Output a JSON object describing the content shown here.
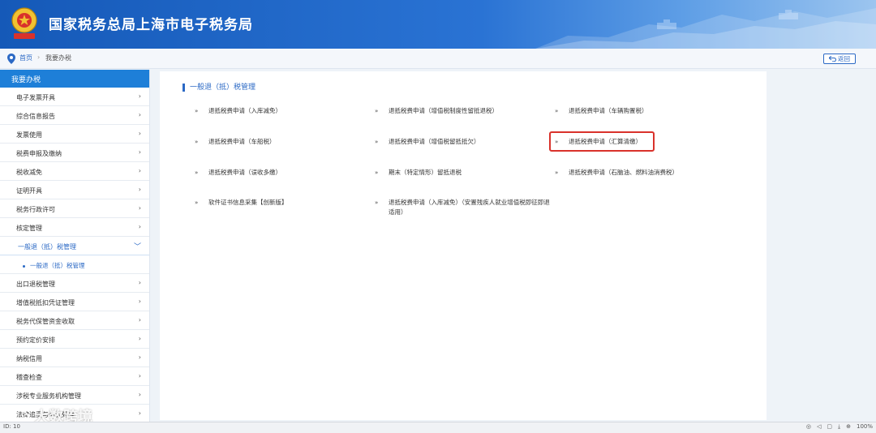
{
  "header": {
    "title": "国家税务总局上海市电子税务局"
  },
  "breadcrumb": {
    "home": "首页",
    "separator": "›",
    "current": "我要办税"
  },
  "back_button": {
    "label": "返回"
  },
  "sidebar": {
    "title": "我要办税",
    "items_before": [
      "电子发票开具",
      "综合信息报告",
      "发票使用",
      "税费申报及缴纳",
      "税收减免",
      "证明开具",
      "税务行政许可",
      "核定管理"
    ],
    "active_item": "一般退（抵）税管理",
    "sub_item": "一般退（抵）税管理",
    "items_after": [
      "出口退税管理",
      "增值税抵扣凭证管理",
      "税务代保管资金收取",
      "预约定价安排",
      "纳税信用",
      "稽查检查",
      "涉税专业服务机构管理",
      "法律追责与争议处理"
    ]
  },
  "main": {
    "title": "一般退（抵）税管理",
    "links": [
      "退抵税费申请（入库减免）",
      "退抵税费申请（增值税制度性留抵退税）",
      "退抵税费申请（车辆购置税）",
      "退抵税费申请（车船税）",
      "退抵税费申请（增值税留抵抵欠）",
      "退抵税费申请（汇算清缴）",
      "退抵税费申请（误收多缴）",
      "期末（特定情形）留抵退税",
      "退抵税费申请（石脑油、燃料油消费税）",
      "软件证书信息采集【创新版】",
      "退抵税费申请（入库减免）（安置残疾人就业增值税即征即退适用）"
    ]
  },
  "statusbar": {
    "left": "ID: 10",
    "zoom": "100%"
  },
  "watermark": "大数跨境"
}
